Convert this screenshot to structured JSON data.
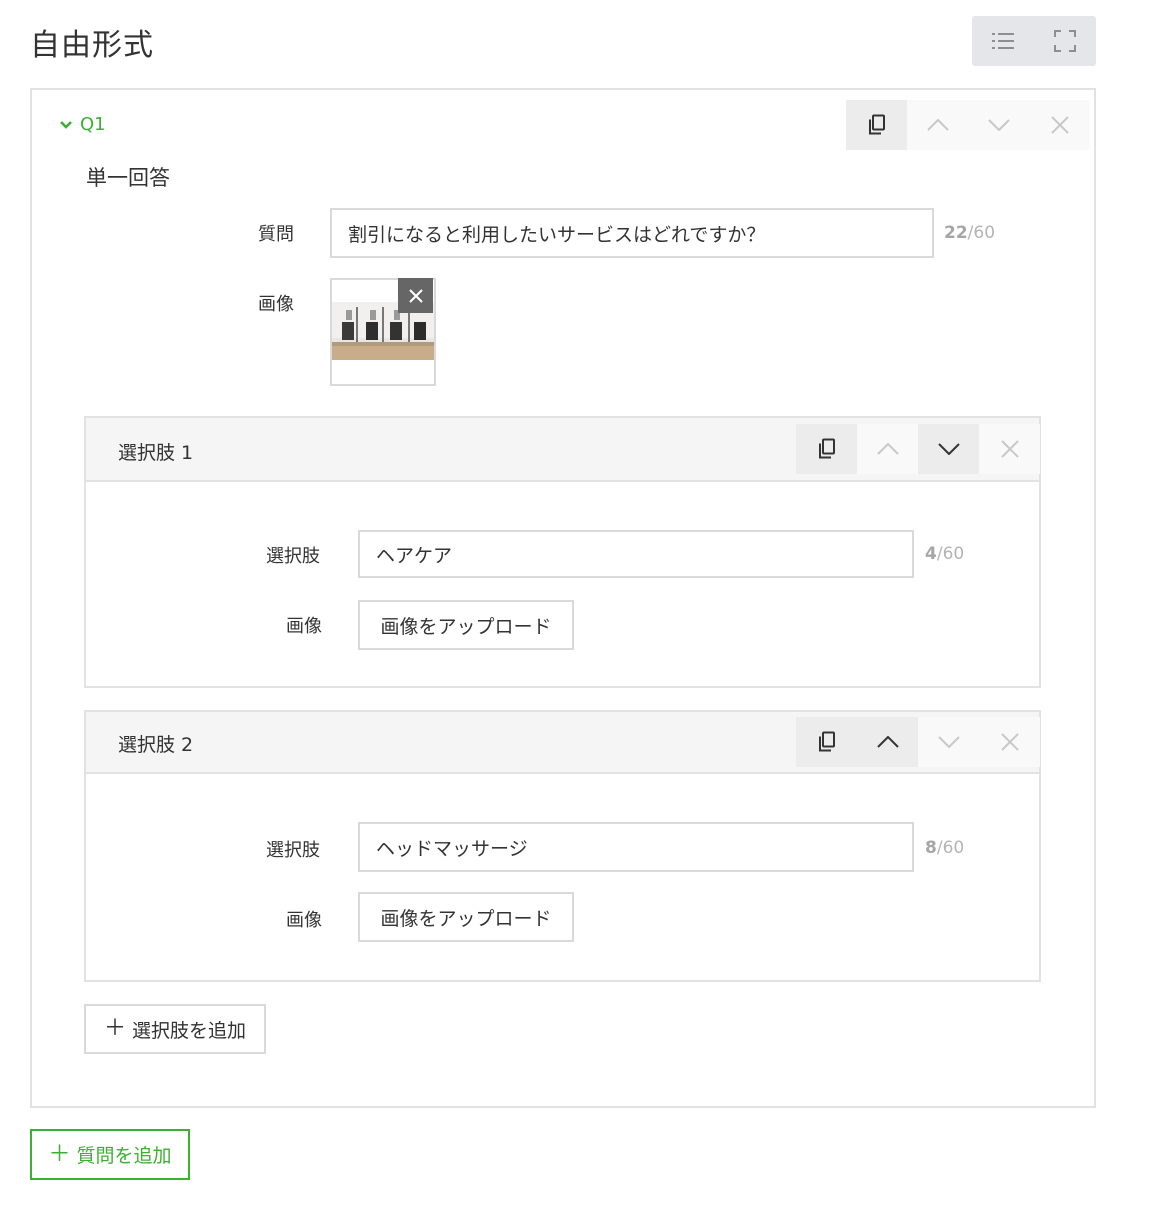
{
  "page": {
    "title": "自由形式"
  },
  "question": {
    "label": "Q1",
    "type_label": "単一回答",
    "question_label": "質問",
    "question_value": "割引になると利用したいサービスはどれですか？",
    "question_count": "22",
    "question_max": "/60",
    "image_label": "画像",
    "image_icon": "photo-thumbnail-chairs"
  },
  "choices": [
    {
      "title": "選択肢 1",
      "field_label": "選択肢",
      "value": "ヘアケア",
      "count": "4",
      "max": "/60",
      "image_label": "画像",
      "upload_label": "画像をアップロード"
    },
    {
      "title": "選択肢 2",
      "field_label": "選択肢",
      "value": "ヘッドマッサージ",
      "count": "8",
      "max": "/60",
      "image_label": "画像",
      "upload_label": "画像をアップロード"
    }
  ],
  "buttons": {
    "add_choice": "選択肢を追加",
    "add_question": "質問を追加",
    "plus": "＋"
  },
  "colors": {
    "accent_green": "#3cb131",
    "border": "#e2e2e2",
    "icon": "#333333",
    "icon_disabled": "#c8c8c8"
  }
}
